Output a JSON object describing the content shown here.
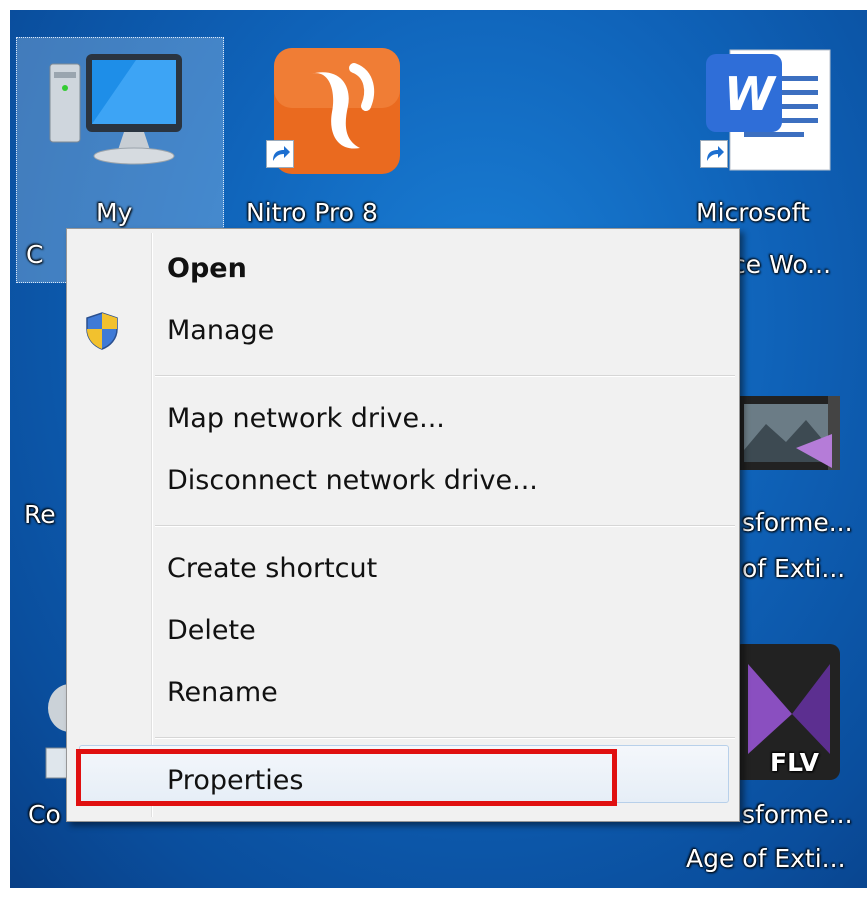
{
  "desktop": {
    "icons": [
      {
        "name": "my-computer",
        "label_line1": "My",
        "label_line2": "C"
      },
      {
        "name": "nitro-pro",
        "label_line1": "Nitro Pro 8"
      },
      {
        "name": "microsoft-word",
        "label_line1": "Microsoft",
        "label_line2": "ce Wo..."
      },
      {
        "name": "recycle-bin",
        "label_line1": "Re"
      },
      {
        "name": "transformers-video-1",
        "label_line1": "sforme...",
        "label_line2": "of Exti..."
      },
      {
        "name": "computer-2",
        "label_line1": "Co"
      },
      {
        "name": "transformers-video-2",
        "label_line1": "sforme...",
        "label_line2": "Age of Exti...",
        "badge": "FLV"
      }
    ]
  },
  "context_menu": {
    "items": [
      {
        "label": "Open",
        "bold": true
      },
      {
        "label": "Manage",
        "icon": "uac-shield-icon"
      },
      {
        "label": "Map network drive..."
      },
      {
        "label": "Disconnect network drive..."
      },
      {
        "label": "Create shortcut"
      },
      {
        "label": "Delete"
      },
      {
        "label": "Rename"
      },
      {
        "label": "Properties",
        "highlighted": true
      }
    ]
  },
  "colors": {
    "desktop_blue": "#0f62b8",
    "menu_bg": "#f1f1f1",
    "highlight_red": "#e01010"
  }
}
